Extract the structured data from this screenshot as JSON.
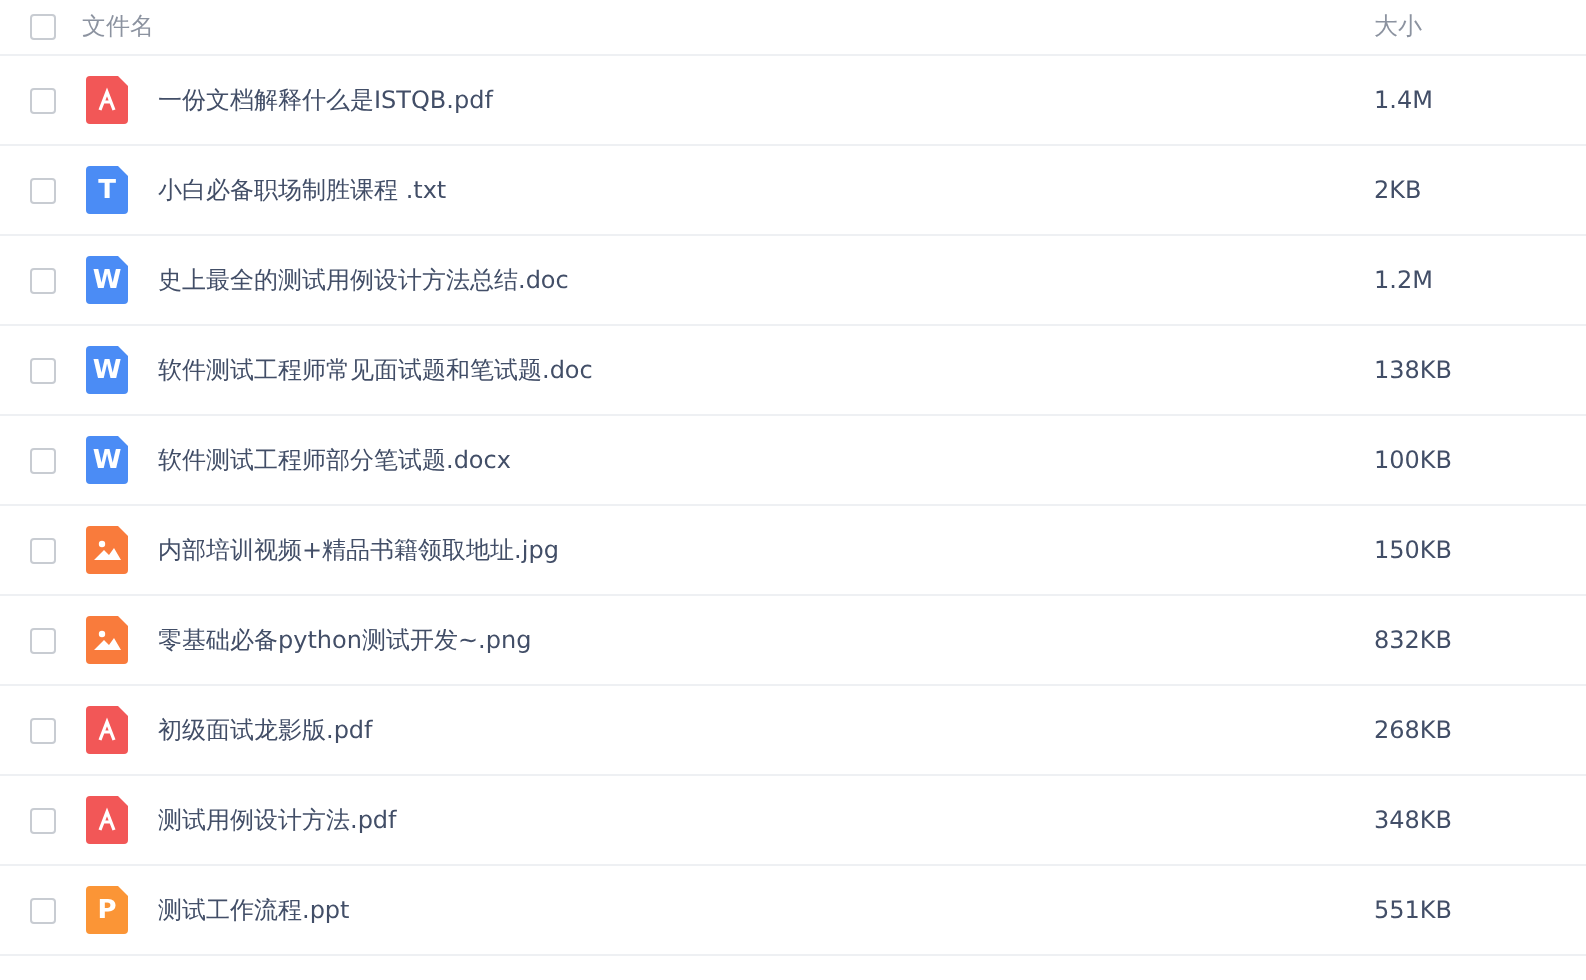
{
  "header": {
    "checked": false,
    "columns": [
      "文件名",
      "大小"
    ]
  },
  "files": [
    {
      "kind": "pdf",
      "name": "一份文档解释什么是ISTQB.pdf",
      "size": "1.4M",
      "checked": false
    },
    {
      "kind": "txt",
      "icon_text": "T",
      "name": "小白必备职场制胜课程 .txt",
      "size": "2KB",
      "checked": false
    },
    {
      "kind": "word",
      "icon_text": "W",
      "name": "史上最全的测试用例设计方法总结.doc",
      "size": "1.2M",
      "checked": false
    },
    {
      "kind": "word",
      "icon_text": "W",
      "name": "软件测试工程师常见面试题和笔试题.doc",
      "size": "138KB",
      "checked": false
    },
    {
      "kind": "word",
      "icon_text": "W",
      "name": "软件测试工程师部分笔试题.docx",
      "size": "100KB",
      "checked": false
    },
    {
      "kind": "image",
      "name": "内部培训视频+精品书籍领取地址.jpg",
      "size": "150KB",
      "checked": false
    },
    {
      "kind": "image",
      "name": "零基础必备python测试开发~.png",
      "size": "832KB",
      "checked": false
    },
    {
      "kind": "pdf",
      "name": "初级面试龙影版.pdf",
      "size": "268KB",
      "checked": false
    },
    {
      "kind": "pdf",
      "name": "测试用例设计方法.pdf",
      "size": "348KB",
      "checked": false
    },
    {
      "kind": "ppt",
      "icon_text": "P",
      "name": "测试工作流程.ppt",
      "size": "551KB",
      "checked": false
    }
  ]
}
